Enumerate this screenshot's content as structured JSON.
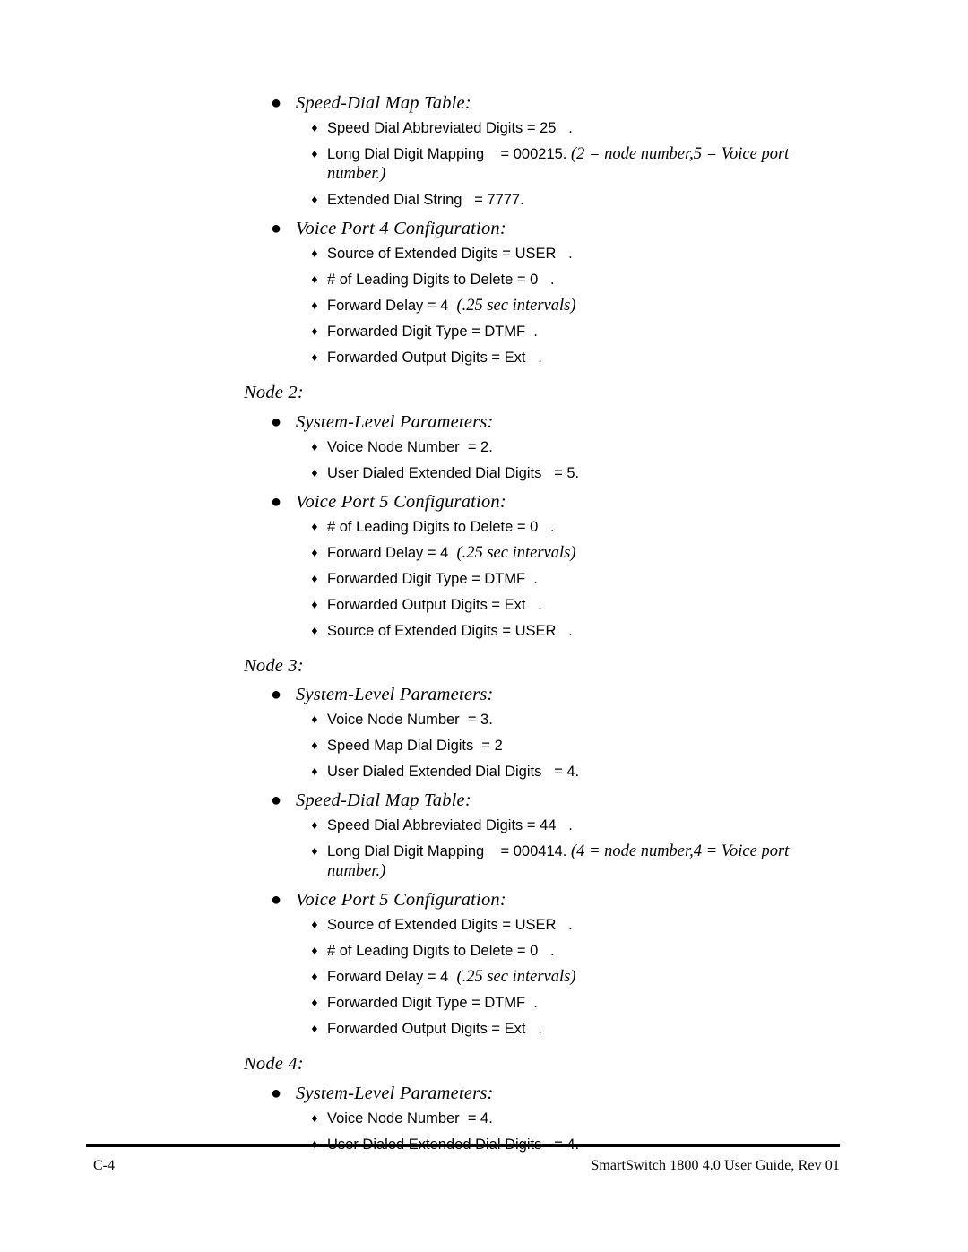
{
  "document": {
    "bullet_level1_glyph": "●",
    "bullet_level2_glyph": "♦"
  },
  "sections": [
    {
      "heading": null,
      "groups": [
        {
          "title": "Speed-Dial Map Table:",
          "items": [
            {
              "text": "Speed Dial Abbreviated Digits = 25   .",
              "italic_tail": ""
            },
            {
              "text": "Long Dial Digit Mapping    = 000215. ",
              "italic_tail": "(2 = node number,5 = Voice port number.)"
            },
            {
              "text": "Extended Dial String   = 7777.",
              "italic_tail": ""
            }
          ]
        },
        {
          "title": "Voice Port 4 Configuration:",
          "items": [
            {
              "text": "Source of Extended Digits = USER   .",
              "italic_tail": ""
            },
            {
              "text": "# of Leading Digits to Delete = 0   .",
              "italic_tail": ""
            },
            {
              "text": "Forward Delay = 4  ",
              "italic_tail": "(.25 sec intervals)"
            },
            {
              "text": "Forwarded Digit Type = DTMF  .",
              "italic_tail": ""
            },
            {
              "text": "Forwarded Output Digits = Ext   .",
              "italic_tail": ""
            }
          ]
        }
      ]
    },
    {
      "heading": "Node 2:",
      "groups": [
        {
          "title": "System-Level Parameters:",
          "items": [
            {
              "text": "Voice Node Number  = 2.",
              "italic_tail": ""
            },
            {
              "text": "User Dialed Extended Dial Digits   = 5.",
              "italic_tail": ""
            }
          ]
        },
        {
          "title": "Voice Port 5 Configuration:",
          "items": [
            {
              "text": "# of Leading Digits to Delete = 0   .",
              "italic_tail": ""
            },
            {
              "text": "Forward Delay = 4  ",
              "italic_tail": "(.25 sec intervals)"
            },
            {
              "text": "Forwarded Digit Type = DTMF  .",
              "italic_tail": ""
            },
            {
              "text": "Forwarded Output Digits = Ext   .",
              "italic_tail": ""
            },
            {
              "text": "Source of Extended Digits = USER   .",
              "italic_tail": ""
            }
          ]
        }
      ]
    },
    {
      "heading": "Node 3:",
      "groups": [
        {
          "title": "System-Level Parameters:",
          "items": [
            {
              "text": "Voice Node Number  = 3.",
              "italic_tail": ""
            },
            {
              "text": "Speed Map Dial Digits  = 2",
              "italic_tail": ""
            },
            {
              "text": "User Dialed Extended Dial Digits   = 4.",
              "italic_tail": ""
            }
          ]
        },
        {
          "title": "Speed-Dial Map Table:",
          "items": [
            {
              "text": "Speed Dial Abbreviated Digits = 44   .",
              "italic_tail": ""
            },
            {
              "text": "Long Dial Digit Mapping    = 000414. ",
              "italic_tail": "(4 = node number,4 = Voice port number.)"
            }
          ]
        },
        {
          "title": "Voice Port 5 Configuration:",
          "items": [
            {
              "text": "Source of Extended Digits = USER   .",
              "italic_tail": ""
            },
            {
              "text": "# of Leading Digits to Delete = 0   .",
              "italic_tail": ""
            },
            {
              "text": "Forward Delay = 4  ",
              "italic_tail": "(.25 sec intervals)"
            },
            {
              "text": "Forwarded Digit Type = DTMF  .",
              "italic_tail": ""
            },
            {
              "text": "Forwarded Output Digits = Ext   .",
              "italic_tail": ""
            }
          ]
        }
      ]
    },
    {
      "heading": "Node 4:",
      "groups": [
        {
          "title": "System-Level Parameters:",
          "items": [
            {
              "text": "Voice Node Number  = 4.",
              "italic_tail": ""
            },
            {
              "text": "User Dialed Extended Dial Digits   = 4.",
              "italic_tail": ""
            }
          ]
        }
      ]
    }
  ],
  "footer": {
    "page_number": "C-4",
    "document_reference": "SmartSwitch 1800 4.0 User Guide, Rev 01"
  }
}
